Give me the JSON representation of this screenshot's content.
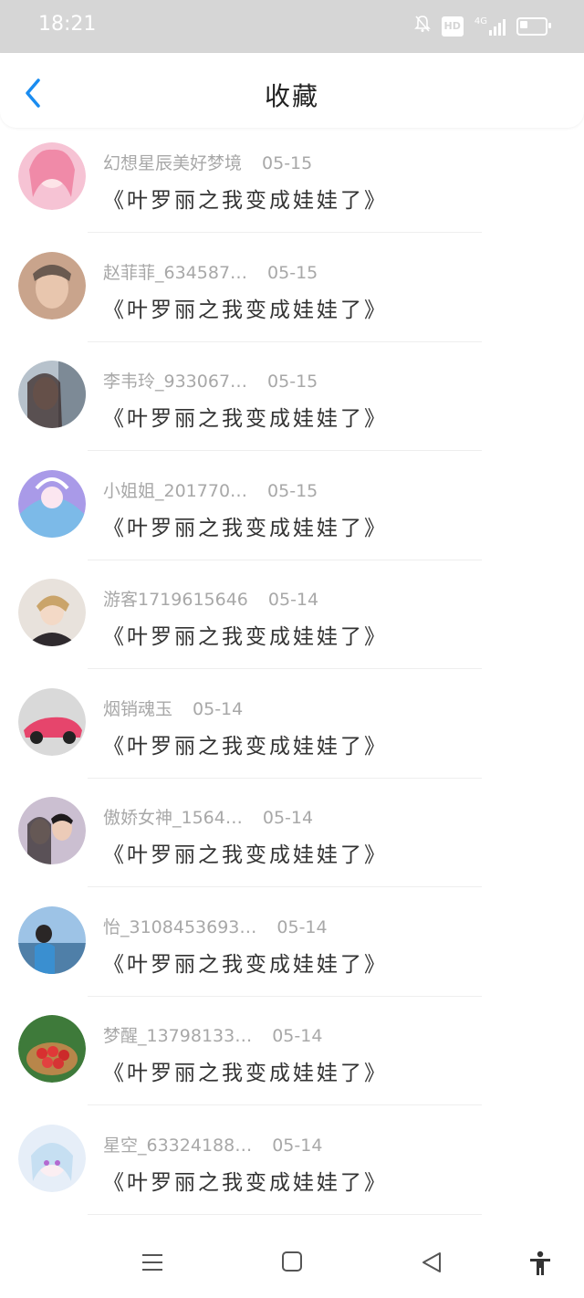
{
  "status_bar": {
    "time": "18:21",
    "icons": [
      "bell-off-icon",
      "hd-icon",
      "signal-4g-icon",
      "battery-icon"
    ],
    "hd_label": "HD",
    "network": "4G"
  },
  "header": {
    "title": "收藏",
    "back_icon": "chevron-left-icon",
    "accent_color": "#1a8cf0"
  },
  "favorites": [
    {
      "user": "幻想星辰美好梦境",
      "date": "05-15",
      "book": "《叶罗丽之我变成娃娃了》",
      "avatar_color": "#f6c3d4"
    },
    {
      "user": "赵菲菲_634587…",
      "date": "05-15",
      "book": "《叶罗丽之我变成娃娃了》",
      "avatar_color": "#b48d78"
    },
    {
      "user": "李韦玲_933067…",
      "date": "05-15",
      "book": "《叶罗丽之我变成娃娃了》",
      "avatar_color": "#6a6a78"
    },
    {
      "user": "小姐姐_201770…",
      "date": "05-15",
      "book": "《叶罗丽之我变成娃娃了》",
      "avatar_color": "#8a7cd8"
    },
    {
      "user": "游客1719615646",
      "date": "05-14",
      "book": "《叶罗丽之我变成娃娃了》",
      "avatar_color": "#4a3a3a"
    },
    {
      "user": "烟销魂玉",
      "date": "05-14",
      "book": "《叶罗丽之我变成娃娃了》",
      "avatar_color": "#e04a6a"
    },
    {
      "user": "傲娇女神_1564…",
      "date": "05-14",
      "book": "《叶罗丽之我变成娃娃了》",
      "avatar_color": "#a89aa6"
    },
    {
      "user": "怡_3108453693…",
      "date": "05-14",
      "book": "《叶罗丽之我变成娃娃了》",
      "avatar_color": "#6fa4cf"
    },
    {
      "user": "梦醒_13798133…",
      "date": "05-14",
      "book": "《叶罗丽之我变成娃娃了》",
      "avatar_color": "#c43a3a"
    },
    {
      "user": "星空_63324188…",
      "date": "05-14",
      "book": "《叶罗丽之我变成娃娃了》",
      "avatar_color": "#d8e6f4"
    }
  ],
  "system_nav": {
    "icons": [
      "menu-icon",
      "home-square-icon",
      "back-triangle-icon",
      "accessibility-icon"
    ]
  }
}
